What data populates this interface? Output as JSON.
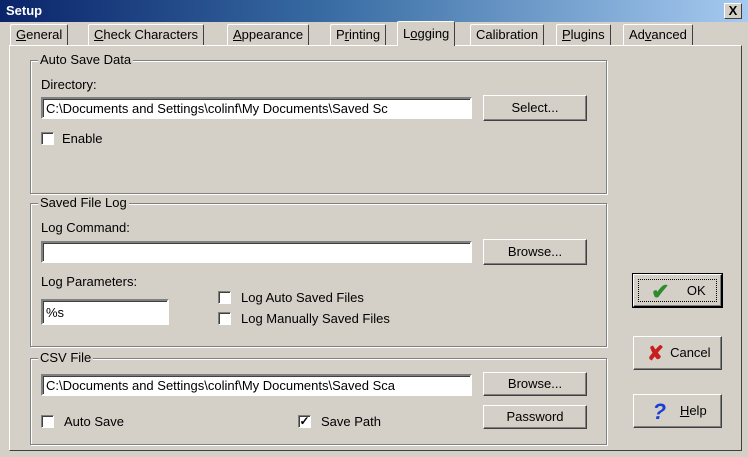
{
  "window": {
    "title": "Setup",
    "close_glyph": "X"
  },
  "tabs": [
    {
      "pre": "",
      "key": "G",
      "post": "eneral"
    },
    {
      "pre": "",
      "key": "C",
      "post": "heck Characters"
    },
    {
      "pre": "",
      "key": "A",
      "post": "ppearance"
    },
    {
      "pre": "P",
      "key": "r",
      "post": "inting"
    },
    {
      "pre": "L",
      "key": "o",
      "post": "gging"
    },
    {
      "pre": "Calibration",
      "key": "",
      "post": ""
    },
    {
      "pre": "",
      "key": "P",
      "post": "lugins"
    },
    {
      "pre": "Ad",
      "key": "v",
      "post": "anced"
    }
  ],
  "active_tab": 4,
  "auto_save": {
    "legend": "Auto Save Data",
    "directory_label": "Directory:",
    "directory_value": "C:\\Documents and Settings\\colinf\\My Documents\\Saved Sc",
    "select_button": "Select...",
    "enable_label": "Enable",
    "enable_checked": false
  },
  "saved_file_log": {
    "legend": "Saved File Log",
    "command_label": "Log Command:",
    "command_value": "",
    "browse_button": "Browse...",
    "params_label": "Log Parameters:",
    "params_value": "%s",
    "log_auto_label": "Log Auto Saved Files",
    "log_auto_checked": false,
    "log_manual_label": "Log Manually Saved Files",
    "log_manual_checked": false
  },
  "csv_file": {
    "legend": "CSV File",
    "path_value": "C:\\Documents and Settings\\colinf\\My Documents\\Saved Sca",
    "browse_button": "Browse...",
    "password_button": "Password",
    "auto_save_label": "Auto Save",
    "auto_save_checked": false,
    "save_path_label": "Save Path",
    "save_path_checked": true
  },
  "buttons": {
    "ok": "OK",
    "cancel": "Cancel",
    "help_key": "H",
    "help_rest": "elp"
  },
  "icons": {
    "ok": "check-icon",
    "cancel": "x-icon",
    "help": "question-icon",
    "check_glyph": "✓"
  },
  "colors": {
    "ok_icon": "#2e8b2e",
    "cancel_icon": "#c81e1e",
    "help_icon": "#1a3ed8",
    "title_start": "#0a246a",
    "title_end": "#a6caf0"
  }
}
